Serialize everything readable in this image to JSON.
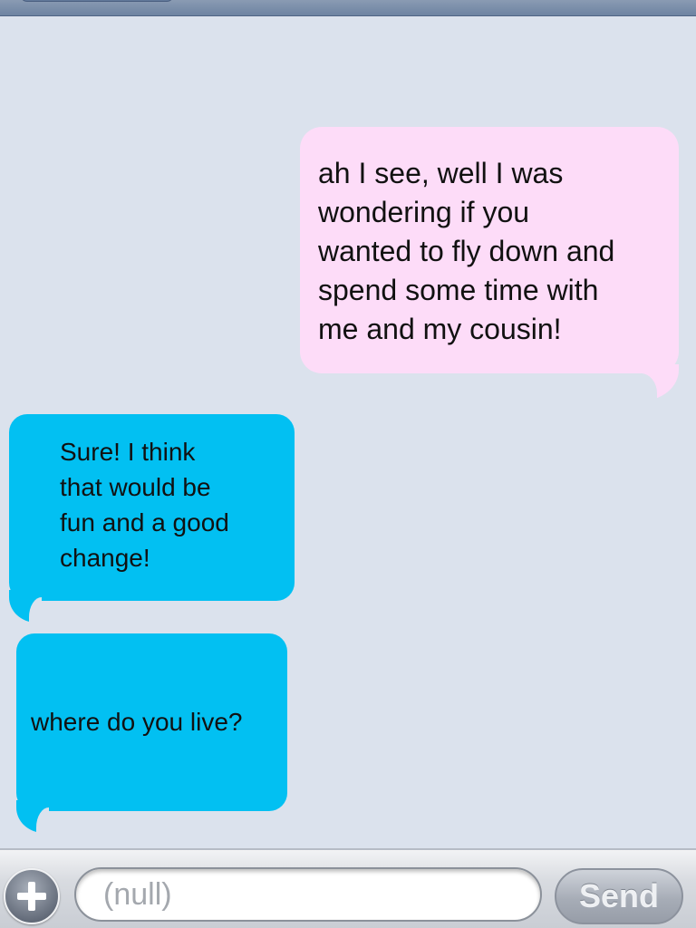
{
  "messages": [
    {
      "direction": "sent",
      "text": "ah I see, well I was\nwondering if you\nwanted to fly down and\nspend some time with\nme and my cousin!",
      "color": "#fddcf8"
    },
    {
      "direction": "received",
      "text": "Sure!  I think\nthat would be\nfun and a good\nchange!",
      "color": "#02c0f2"
    },
    {
      "direction": "received",
      "text": "where do you live?",
      "color": "#02c0f2"
    }
  ],
  "input_bar": {
    "add_icon": "plus-icon",
    "text_field_value": "(null)",
    "send_label": "Send"
  },
  "colors": {
    "background": "#dbe2ed",
    "sent_bubble": "#fddcf8",
    "received_bubble": "#02c0f2"
  }
}
